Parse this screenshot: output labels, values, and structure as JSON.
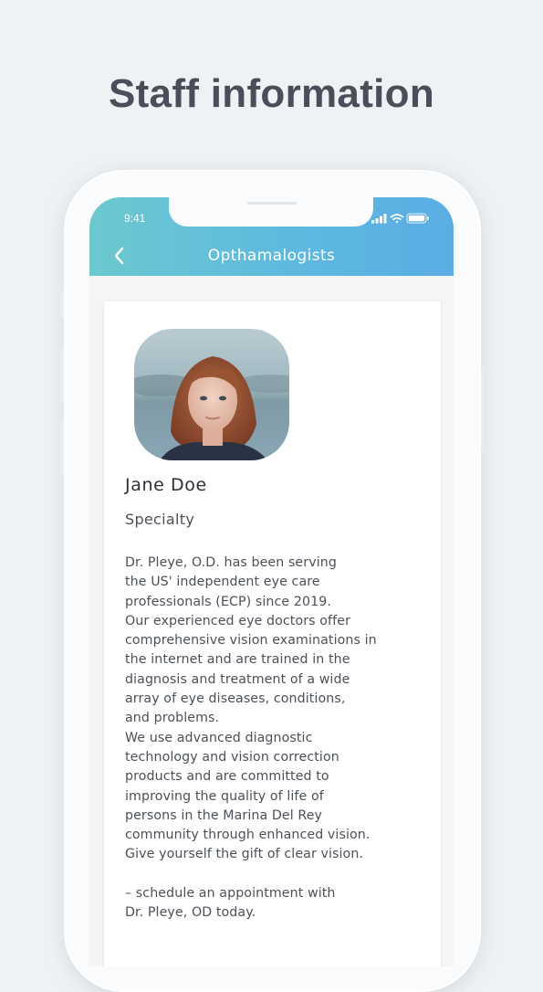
{
  "headline": "Staff information",
  "status_bar": {
    "time": "9:41",
    "icons": [
      "signal-icon",
      "wifi-icon",
      "battery-icon"
    ]
  },
  "navbar": {
    "back_icon": "chevron-left-icon",
    "title": "Opthamalogists"
  },
  "profile": {
    "name": "Jane Doe",
    "specialty": "Specialty",
    "bio_lines": [
      "Dr. Pleye, O.D. has been serving",
      "the US' independent eye care",
      "professionals (ECP) since 2019.",
      "Our experienced eye doctors offer",
      "comprehensive vision examinations in",
      "the internet and are trained in the",
      "diagnosis and treatment of a wide",
      "array of eye diseases, conditions,",
      "and problems.",
      "We use advanced diagnostic",
      "technology and vision correction",
      "products and are committed to",
      "improving the quality of life of",
      "persons in the Marina Del Rey",
      "community through enhanced vision.",
      "Give yourself the gift of clear vision."
    ],
    "cta_lines": [
      "– schedule an appointment with",
      "Dr. Pleye, OD today."
    ]
  },
  "colors": {
    "header_gradient_start": "#6cc8cf",
    "header_gradient_end": "#5aade4",
    "headline_text": "#4a4e5a",
    "background": "#eff2f4"
  }
}
